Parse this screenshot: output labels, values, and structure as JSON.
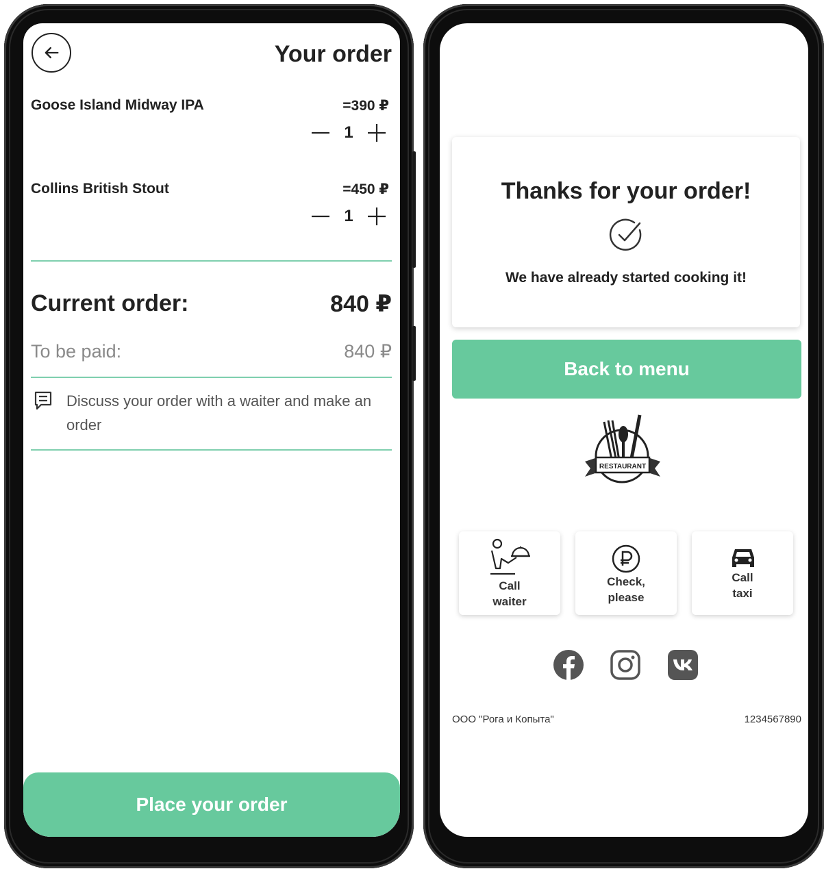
{
  "order_screen": {
    "title": "Your order",
    "items": [
      {
        "name": "Goose Island Midway IPA",
        "price": "=390 ₽",
        "quantity": "1"
      },
      {
        "name": "Collins British Stout",
        "price": "=450 ₽",
        "quantity": "1"
      }
    ],
    "current_order_label": "Current order:",
    "current_order_value": "840 ₽",
    "to_be_paid_label": "To be paid:",
    "to_be_paid_value": "840 ₽",
    "note": "Discuss your order with a waiter and make an order",
    "place_order_label": "Place your order"
  },
  "confirmation_screen": {
    "thanks_title": "Thanks for your order!",
    "thanks_subtitle": "We have already started cooking it!",
    "back_to_menu_label": "Back to menu",
    "logo_text": "RESTAURANT",
    "services": [
      {
        "label_line1": "Call",
        "label_line2": "waiter",
        "icon": "waiter-icon"
      },
      {
        "label_line1": "Check,",
        "label_line2": "please",
        "icon": "ruble-icon"
      },
      {
        "label_line1": "Call",
        "label_line2": "taxi",
        "icon": "car-icon"
      }
    ],
    "social": [
      "facebook-icon",
      "instagram-icon",
      "vk-icon"
    ],
    "footer_company": "ООО \"Рога и Копыта\"",
    "footer_phone": "1234567890"
  },
  "colors": {
    "accent": "#67c99d",
    "divider": "#7fcfae",
    "text": "#222222",
    "muted": "#8a8a8a"
  }
}
